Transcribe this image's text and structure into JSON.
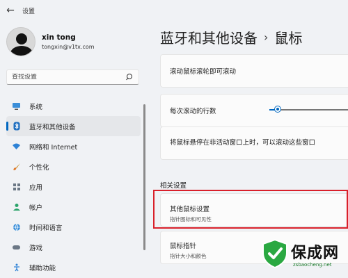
{
  "window": {
    "title": "设置",
    "back_glyph": "←"
  },
  "profile": {
    "name": "xin tong",
    "email": "tongxin@v1tx.com"
  },
  "search": {
    "placeholder": "查找设置"
  },
  "sidebar": {
    "items": [
      {
        "label": "系统",
        "icon": "monitor-icon",
        "active": false
      },
      {
        "label": "蓝牙和其他设备",
        "icon": "bluetooth-icon",
        "active": true
      },
      {
        "label": "网络和 Internet",
        "icon": "wifi-icon",
        "active": false
      },
      {
        "label": "个性化",
        "icon": "brush-icon",
        "active": false
      },
      {
        "label": "应用",
        "icon": "apps-icon",
        "active": false
      },
      {
        "label": "帐户",
        "icon": "person-icon",
        "active": false
      },
      {
        "label": "时间和语言",
        "icon": "globe-icon",
        "active": false
      },
      {
        "label": "游戏",
        "icon": "gamepad-icon",
        "active": false
      },
      {
        "label": "辅助功能",
        "icon": "accessibility-icon",
        "active": false
      }
    ]
  },
  "breadcrumb": {
    "parent": "蓝牙和其他设备",
    "separator": "›",
    "current": "鼠标"
  },
  "settings": {
    "scroll_inactive": "滚动鼠标滚轮即可滚动",
    "lines_to_scroll": "每次滚动的行数",
    "lines_to_scroll_level": 0.05,
    "hover_inactive_scroll": "将鼠标悬停在非活动窗口上时，可以滚动这些窗口"
  },
  "related": {
    "title": "相关设置",
    "items": [
      {
        "title": "其他鼠标设置",
        "subtitle": "指针图标和可见性"
      },
      {
        "title": "鼠标指针",
        "subtitle": "指针大小和颜色"
      }
    ]
  },
  "watermark": {
    "title": "保成网",
    "url": "zsbaocheng.net"
  },
  "colors": {
    "accent": "#0067c0",
    "highlight_box": "#d9202a",
    "sidebar_active": "#e5e7ea"
  }
}
